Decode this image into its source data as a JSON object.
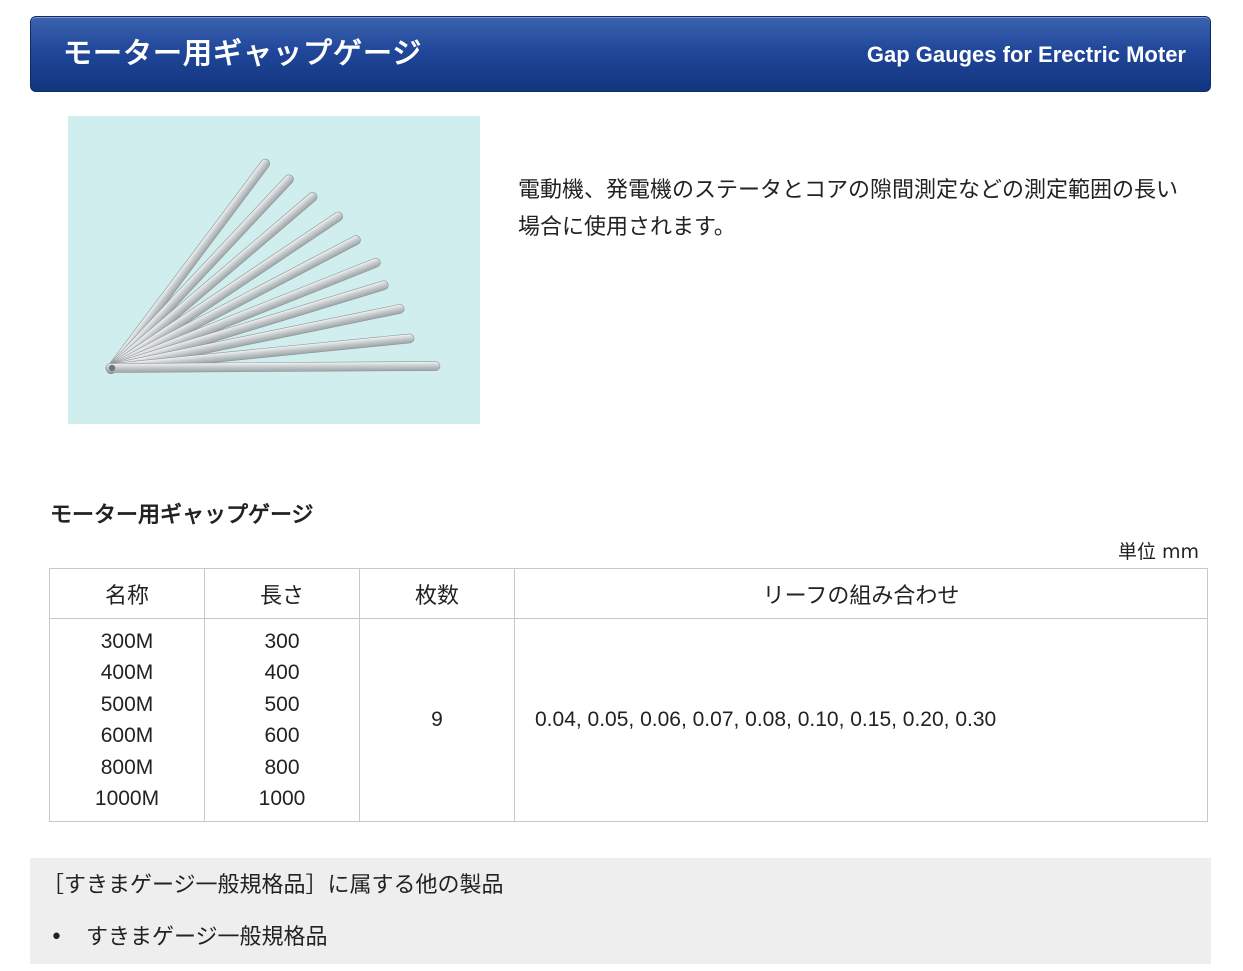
{
  "header": {
    "title_jp": "モーター用ギャップゲージ",
    "title_en": "Gap Gauges for Erectric Moter"
  },
  "image": {
    "icon": "gap-gauge-fan-image"
  },
  "description": "電動機、発電機のステータとコアの隙間測定などの測定範囲の長い場合に使用されます。",
  "table_section": {
    "title": "モーター用ギャップゲージ",
    "unit": "単位 mm",
    "headers": [
      "名称",
      "長さ",
      "枚数",
      "リーフの組み合わせ"
    ],
    "models": [
      "300M",
      "400M",
      "500M",
      "600M",
      "800M",
      "1000M"
    ],
    "lengths": [
      "300",
      "400",
      "500",
      "600",
      "800",
      "1000"
    ],
    "count": "9",
    "leaf_combination": "0.04, 0.05, 0.06, 0.07, 0.08, 0.10, 0.15, 0.20, 0.30"
  },
  "related": {
    "heading": "［すきまゲージ一般規格品］に属する他の製品",
    "items": [
      "すきまゲージ一般規格品"
    ]
  }
}
